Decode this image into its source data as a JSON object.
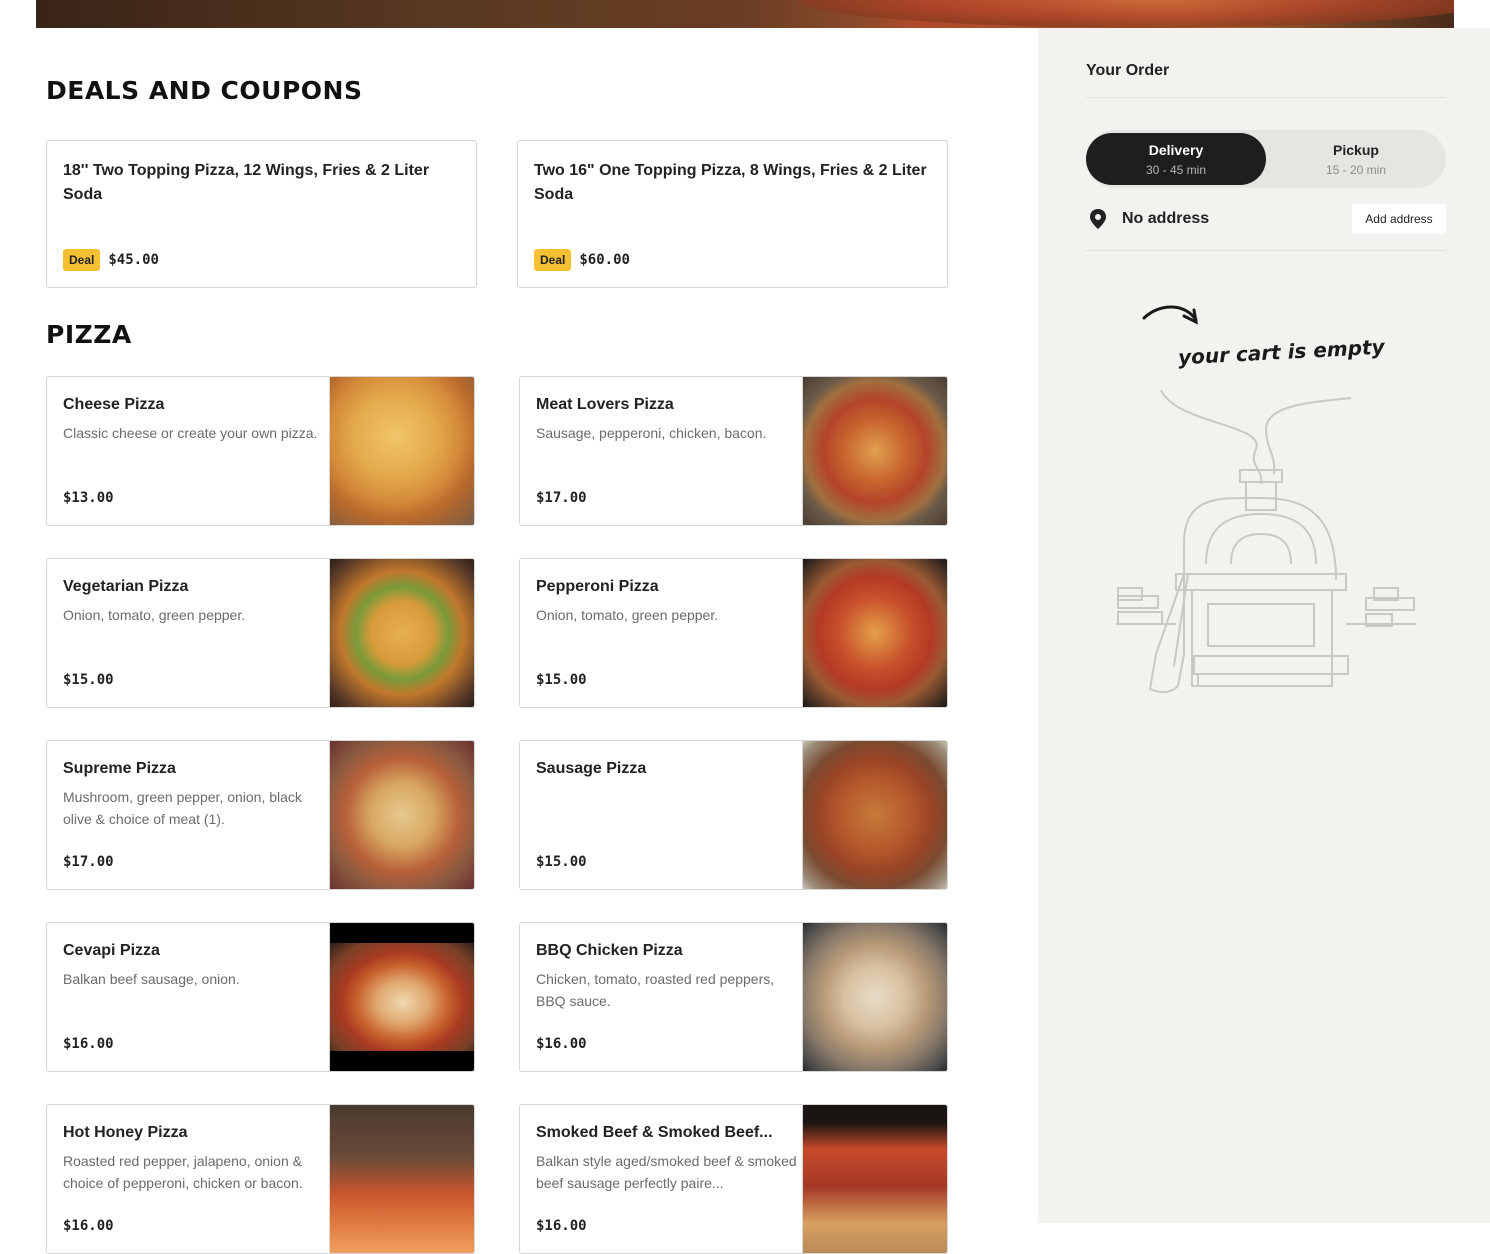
{
  "deals": {
    "title": "DEALS AND COUPONS",
    "items": [
      {
        "name": "18'' Two Topping Pizza, 12 Wings, Fries & 2 Liter Soda",
        "badge": "Deal",
        "price": "$45.00"
      },
      {
        "name": "Two 16\" One Topping Pizza, 8 Wings, Fries & 2 Liter Soda",
        "badge": "Deal",
        "price": "$60.00"
      }
    ]
  },
  "pizza": {
    "title": "PIZZA",
    "items": [
      {
        "name": "Cheese Pizza",
        "desc": "Classic cheese or create your own pizza.",
        "price": "$13.00"
      },
      {
        "name": "Meat Lovers Pizza",
        "desc": "Sausage, pepperoni, chicken, bacon.",
        "price": "$17.00"
      },
      {
        "name": "Vegetarian Pizza",
        "desc": "Onion, tomato, green pepper.",
        "price": "$15.00"
      },
      {
        "name": "Pepperoni Pizza",
        "desc": "Onion, tomato, green pepper.",
        "price": "$15.00"
      },
      {
        "name": "Supreme Pizza",
        "desc": "Mushroom, green pepper, onion, black olive & choice of meat (1).",
        "price": "$17.00"
      },
      {
        "name": "Sausage Pizza",
        "desc": "",
        "price": "$15.00"
      },
      {
        "name": "Cevapi Pizza",
        "desc": "Balkan beef sausage, onion.",
        "price": "$16.00"
      },
      {
        "name": "BBQ Chicken Pizza",
        "desc": "Chicken, tomato, roasted red peppers, BBQ sauce.",
        "price": "$16.00"
      },
      {
        "name": "Hot Honey Pizza",
        "desc": "Roasted red pepper, jalapeno, onion & choice of pepperoni, chicken or bacon.",
        "price": "$16.00"
      },
      {
        "name": "Smoked Beef & Smoked Beef...",
        "desc": "Balkan style aged/smoked beef & smoked beef sausage perfectly paire...",
        "price": "$16.00"
      }
    ]
  },
  "order": {
    "title": "Your Order",
    "delivery": {
      "label": "Delivery",
      "time": "30 - 45 min"
    },
    "pickup": {
      "label": "Pickup",
      "time": "15 - 20 min"
    },
    "address": "No address",
    "add_address": "Add address",
    "empty_text": "your cart is empty"
  },
  "icons": {
    "pin": "location-pin-icon",
    "arrow": "curved-arrow-icon"
  },
  "colors": {
    "deal_badge": "#f6c033",
    "sidebar_bg": "#f3f2ef",
    "active_toggle": "#1e1e1e"
  }
}
